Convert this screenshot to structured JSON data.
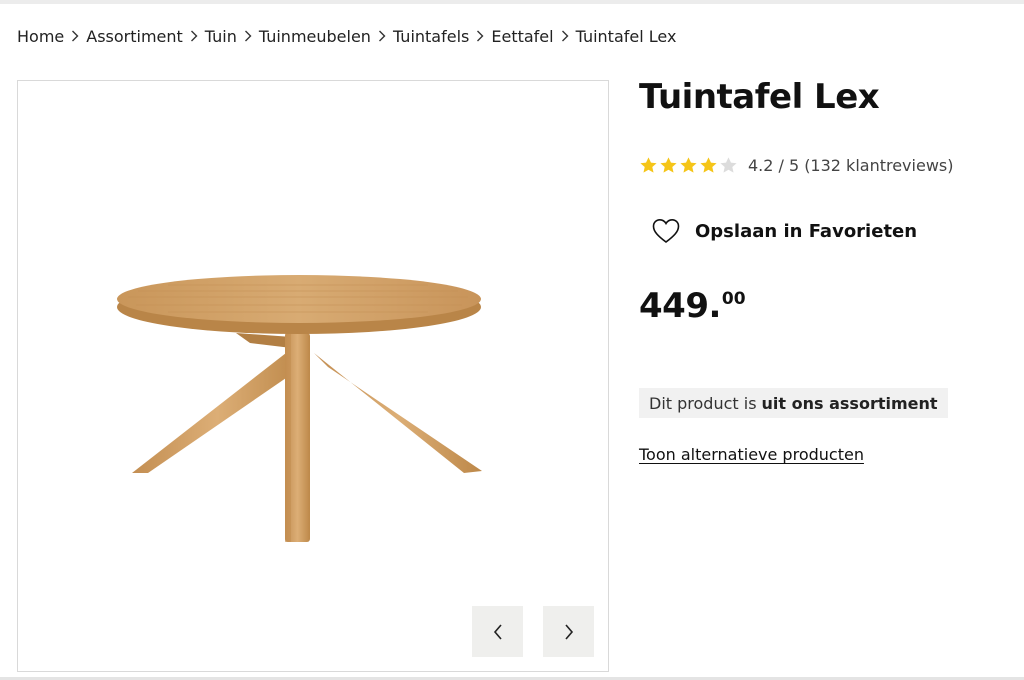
{
  "breadcrumb": {
    "items": [
      "Home",
      "Assortiment",
      "Tuin",
      "Tuinmeubelen",
      "Tuintafels",
      "Eettafel",
      "Tuintafel Lex"
    ]
  },
  "product": {
    "title": "Tuintafel Lex",
    "rating": {
      "score_text": "4.2 / 5",
      "reviews_text": "(132 klantreviews)",
      "stars_filled": 4,
      "stars_total": 5,
      "star_color": "#f5c518",
      "star_empty_color": "#dcdcdc"
    },
    "favorite_label": "Opslaan in Favorieten",
    "price": {
      "whole": "449.",
      "cents": "00"
    },
    "availability": {
      "prefix": "Dit product is",
      "emphasis": "uit ons assortiment"
    },
    "alternatives_link": "Toon alternatieve producten"
  },
  "gallery": {
    "prev_icon": "chevron-left-icon",
    "next_icon": "chevron-right-icon",
    "image_subject": "round wooden table"
  },
  "colors": {
    "wood_light": "#d6a56b",
    "wood_dark": "#b98548",
    "button_bg": "#efefed"
  }
}
